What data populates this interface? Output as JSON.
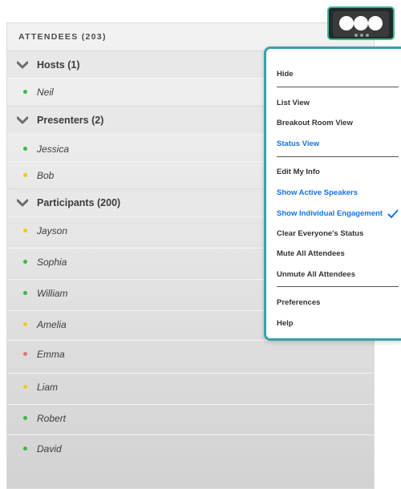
{
  "panel": {
    "header": "ATTENDEES (203)"
  },
  "groups": {
    "hosts": "Hosts (1)",
    "presenters": "Presenters (2)",
    "participants": "Participants (200)"
  },
  "people": {
    "neil": "Neil",
    "jessica": "Jessica",
    "bob": "Bob",
    "jayson": "Jayson",
    "sophia": "Sophia",
    "william": "William",
    "amelia": "Amelia",
    "emma": "Emma",
    "liam": "Liam",
    "robert": "Robert",
    "david": "David"
  },
  "status_colors": {
    "green": "#3cb54a",
    "yellow": "#f2c81e",
    "red": "#e87070"
  },
  "menu": {
    "hide": "Hide",
    "list_view": "List View",
    "breakout_room_view": "Breakout Room View",
    "status_view": "Status View",
    "edit_my_info": "Edit My Info",
    "show_active_speakers": "Show Active Speakers",
    "show_individual_engagement": "Show Individual Engagement",
    "clear_everyones_status": "Clear Everyone's Status",
    "mute_all_attendees": "Mute All Attendees",
    "unmute_all_attendees": "Unmute All Attendees",
    "preferences": "Preferences",
    "help": "Help"
  },
  "icons": {
    "more": "more-options-icon",
    "check": "checkmark-icon",
    "expand": "chevron-down-icon"
  }
}
